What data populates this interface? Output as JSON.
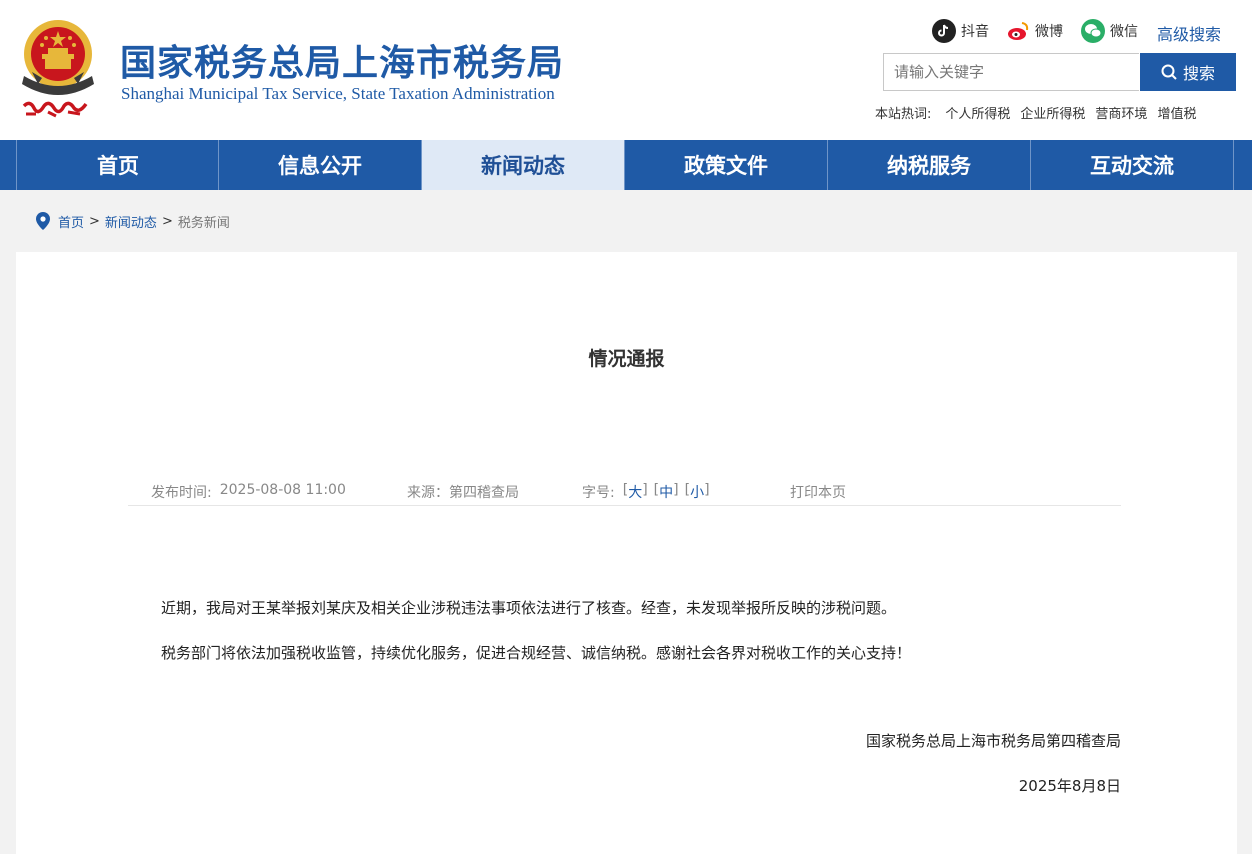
{
  "header": {
    "site_title": "国家税务总局上海市税务局",
    "site_subtitle": "Shanghai Municipal Tax Service, State Taxation Administration",
    "social": [
      {
        "label": "抖音",
        "icon": "douyin-icon",
        "color": "#222222"
      },
      {
        "label": "微博",
        "icon": "weibo-icon",
        "color": "#e6162d"
      },
      {
        "label": "微信",
        "icon": "wechat-icon",
        "color": "#2aae67"
      }
    ],
    "advanced_search": "高级搜索",
    "search": {
      "placeholder": "请输入关键字",
      "button": "搜索"
    },
    "hot_label": "本站热词:",
    "hot_words": [
      "个人所得税",
      "企业所得税",
      "营商环境",
      "增值税"
    ]
  },
  "nav": {
    "items": [
      "首页",
      "信息公开",
      "新闻动态",
      "政策文件",
      "纳税服务",
      "互动交流"
    ],
    "active": "新闻动态"
  },
  "breadcrumb": {
    "home": "首页",
    "section": "新闻动态",
    "current": "税务新闻",
    "separator": ">"
  },
  "article": {
    "title": "情况通报",
    "publish_label": "发布时间:",
    "publish_time": "2025-08-08 11:00",
    "source_label": "来源：",
    "source": "第四稽查局",
    "font_label": "字号:",
    "font_large": "大",
    "font_medium": "中",
    "font_small": "小",
    "print": "打印本页",
    "paragraphs": [
      "近期，我局对王某举报刘某庆及相关企业涉税违法事项依法进行了核查。经查，未发现举报所反映的涉税问题。",
      "税务部门将依法加强税收监管，持续优化服务，促进合规经营、诚信纳税。感谢社会各界对税收工作的关心支持！"
    ],
    "signature": "国家税务总局上海市税务局第四稽查局",
    "date": "2025年8月8日"
  },
  "colors": {
    "brand_blue": "#1f5aa6",
    "nav_active_bg": "#dfe9f6",
    "page_bg": "#f2f2f2",
    "emblem_red": "#c8161d",
    "emblem_gold": "#e7b73a"
  }
}
